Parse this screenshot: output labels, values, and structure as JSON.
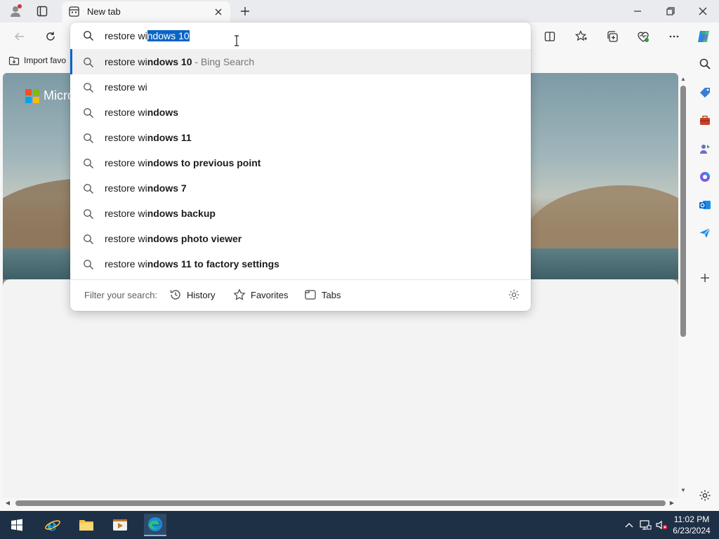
{
  "browser": {
    "tab": {
      "title": "New tab"
    }
  },
  "favorites_bar": {
    "import_label": "Import favo"
  },
  "content": {
    "brand": "Micro"
  },
  "address": {
    "typed": "restore wi",
    "autocomplete_selected": "ndows 10"
  },
  "suggestions": [
    {
      "prefix": "restore wi",
      "bold": "ndows 10",
      "hint": " - Bing Search",
      "active": true
    },
    {
      "prefix": "restore wi",
      "bold": "",
      "hint": "",
      "active": false
    },
    {
      "prefix": "restore wi",
      "bold": "ndows",
      "hint": "",
      "active": false
    },
    {
      "prefix": "restore wi",
      "bold": "ndows 11",
      "hint": "",
      "active": false
    },
    {
      "prefix": "restore wi",
      "bold": "ndows to previous point",
      "hint": "",
      "active": false
    },
    {
      "prefix": "restore wi",
      "bold": "ndows 7",
      "hint": "",
      "active": false
    },
    {
      "prefix": "restore wi",
      "bold": "ndows backup",
      "hint": "",
      "active": false
    },
    {
      "prefix": "restore wi",
      "bold": "ndows photo viewer",
      "hint": "",
      "active": false
    },
    {
      "prefix": "restore wi",
      "bold": "ndows 11 to factory settings",
      "hint": "",
      "active": false
    }
  ],
  "filter": {
    "label": "Filter your search:",
    "history": "History",
    "favorites": "Favorites",
    "tabs": "Tabs"
  },
  "taskbar": {
    "time": "11:02 PM",
    "date": "6/23/2024"
  },
  "colors": {
    "accent": "#0a64c8",
    "taskbar": "#1e3046"
  }
}
